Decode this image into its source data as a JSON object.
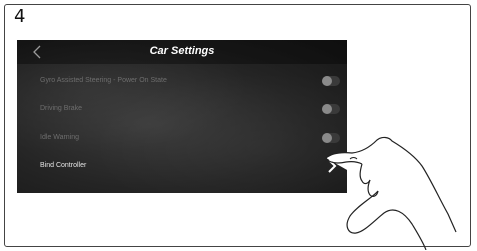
{
  "step": {
    "number": "4"
  },
  "screen": {
    "title": "Car Settings",
    "back_icon": "chevron-left-icon",
    "settings": [
      {
        "label": "Gyro Assisted Steering - Power On State",
        "control": "toggle",
        "enabled": false
      },
      {
        "label": "Driving Brake",
        "control": "toggle",
        "enabled": false
      },
      {
        "label": "Idle Warning",
        "control": "toggle",
        "enabled": false
      },
      {
        "label": "Bind Controller",
        "control": "chevron-right-icon",
        "enabled": true
      }
    ]
  },
  "colors": {
    "screen_background": "#242424",
    "active_text": "#e6e6e6",
    "inactive_text": "#6e6e6e",
    "toggle_off_knob": "#8a8a8a"
  },
  "overlay": {
    "icon": "pointing-hand-icon"
  }
}
